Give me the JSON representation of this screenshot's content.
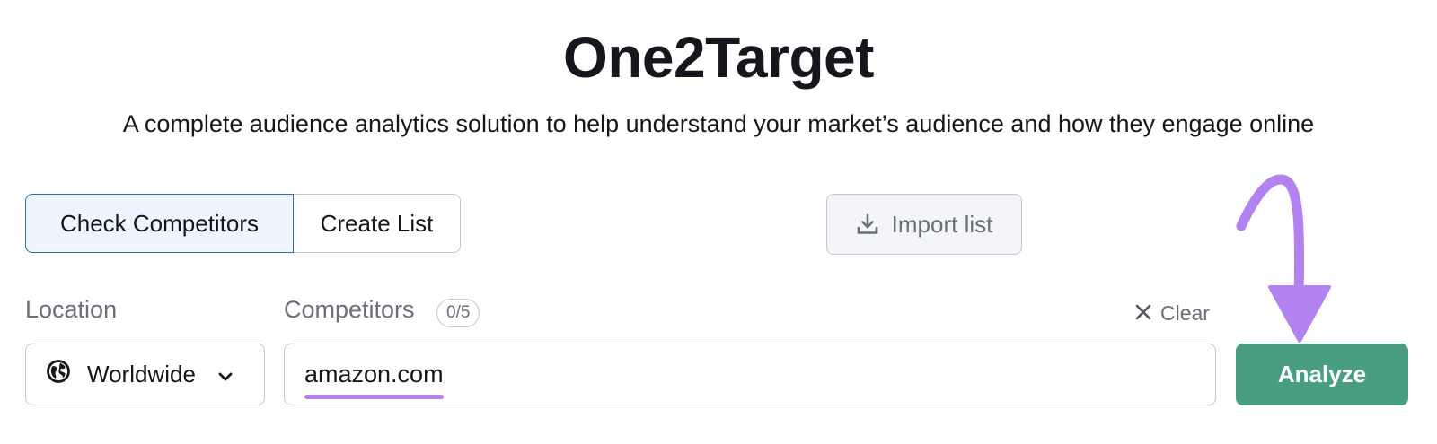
{
  "header": {
    "title": "One2Target",
    "subtitle": "A complete audience analytics solution to help understand your market’s audience and how they engage online"
  },
  "modes": {
    "check_competitors": "Check Competitors",
    "create_list": "Create List",
    "active": "Check Competitors"
  },
  "import": {
    "label": "Import list",
    "icon": "download-icon"
  },
  "location": {
    "label": "Location",
    "value": "Worldwide",
    "icon": "globe-icon"
  },
  "competitors": {
    "label": "Competitors",
    "count": "0/5",
    "value": "amazon.com"
  },
  "clear": {
    "label": "Clear",
    "icon": "close-icon"
  },
  "analyze": {
    "label": "Analyze"
  },
  "colors": {
    "analyze_bg": "#4a9e80",
    "active_mode_bg": "#eef5ff",
    "active_mode_border": "#2f6fa8",
    "annotation": "#b283f0"
  }
}
